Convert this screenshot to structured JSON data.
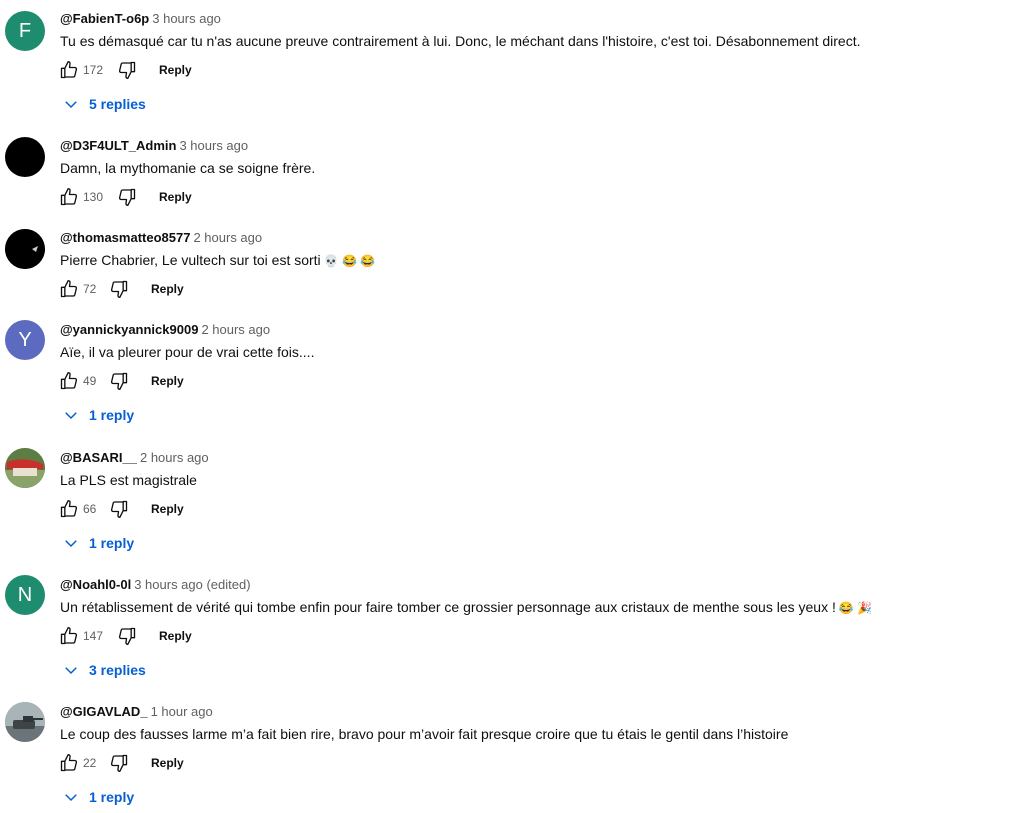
{
  "labels": {
    "reply": "Reply"
  },
  "comments": [
    {
      "author": "@FabienT-o6p",
      "time": "3 hours ago",
      "text": "Tu es démasqué car tu n'as aucune preuve contrairement à lui. Donc, le méchant dans l'histoire, c'est toi. Désabonnement direct.",
      "likes": "172",
      "avatar_letter": "F",
      "avatar_color": "#1e8c6e",
      "replies": "5 replies"
    },
    {
      "author": "@D3F4ULT_Admin",
      "time": "3 hours ago",
      "text": "Damn, la mythomanie ca se soigne frère.",
      "likes": "130",
      "avatar_letter": "",
      "avatar_color": "#000000",
      "replies": ""
    },
    {
      "author": "@thomasmatteo8577",
      "time": "2 hours ago",
      "text": "Pierre Chabrier, Le vultech sur toi est sorti",
      "emoji": "💀 😂 😂",
      "likes": "72",
      "avatar_letter": "",
      "avatar_color": "#000000",
      "replies": ""
    },
    {
      "author": "@yannickyannick9009",
      "time": "2 hours ago",
      "text": "Aïe, il va pleurer pour de vrai cette fois....",
      "likes": "49",
      "avatar_letter": "Y",
      "avatar_color": "#5c6bc0",
      "replies": "1 reply"
    },
    {
      "author": "@BASARI__",
      "time": "2 hours ago",
      "text": "La PLS est magistrale",
      "likes": "66",
      "avatar_letter": "",
      "avatar_color": "#6b8e4e",
      "replies": "1 reply"
    },
    {
      "author": "@Noahl0-0l",
      "time": "3 hours ago (edited)",
      "text": "Un rétablissement de vérité qui tombe enfin pour faire tomber ce grossier personnage aux cristaux de menthe sous les yeux !",
      "emoji": "😂 🎉",
      "likes": "147",
      "avatar_letter": "N",
      "avatar_color": "#1e8c6e",
      "replies": "3 replies"
    },
    {
      "author": "@GIGAVLAD_",
      "time": "1 hour ago",
      "text": "Le coup des fausses larme m’a fait bien rire, bravo pour m’avoir fait presque croire que tu étais le gentil dans l’histoire",
      "likes": "22",
      "avatar_letter": "",
      "avatar_color": "#7d8a8f",
      "replies": "1 reply"
    }
  ]
}
